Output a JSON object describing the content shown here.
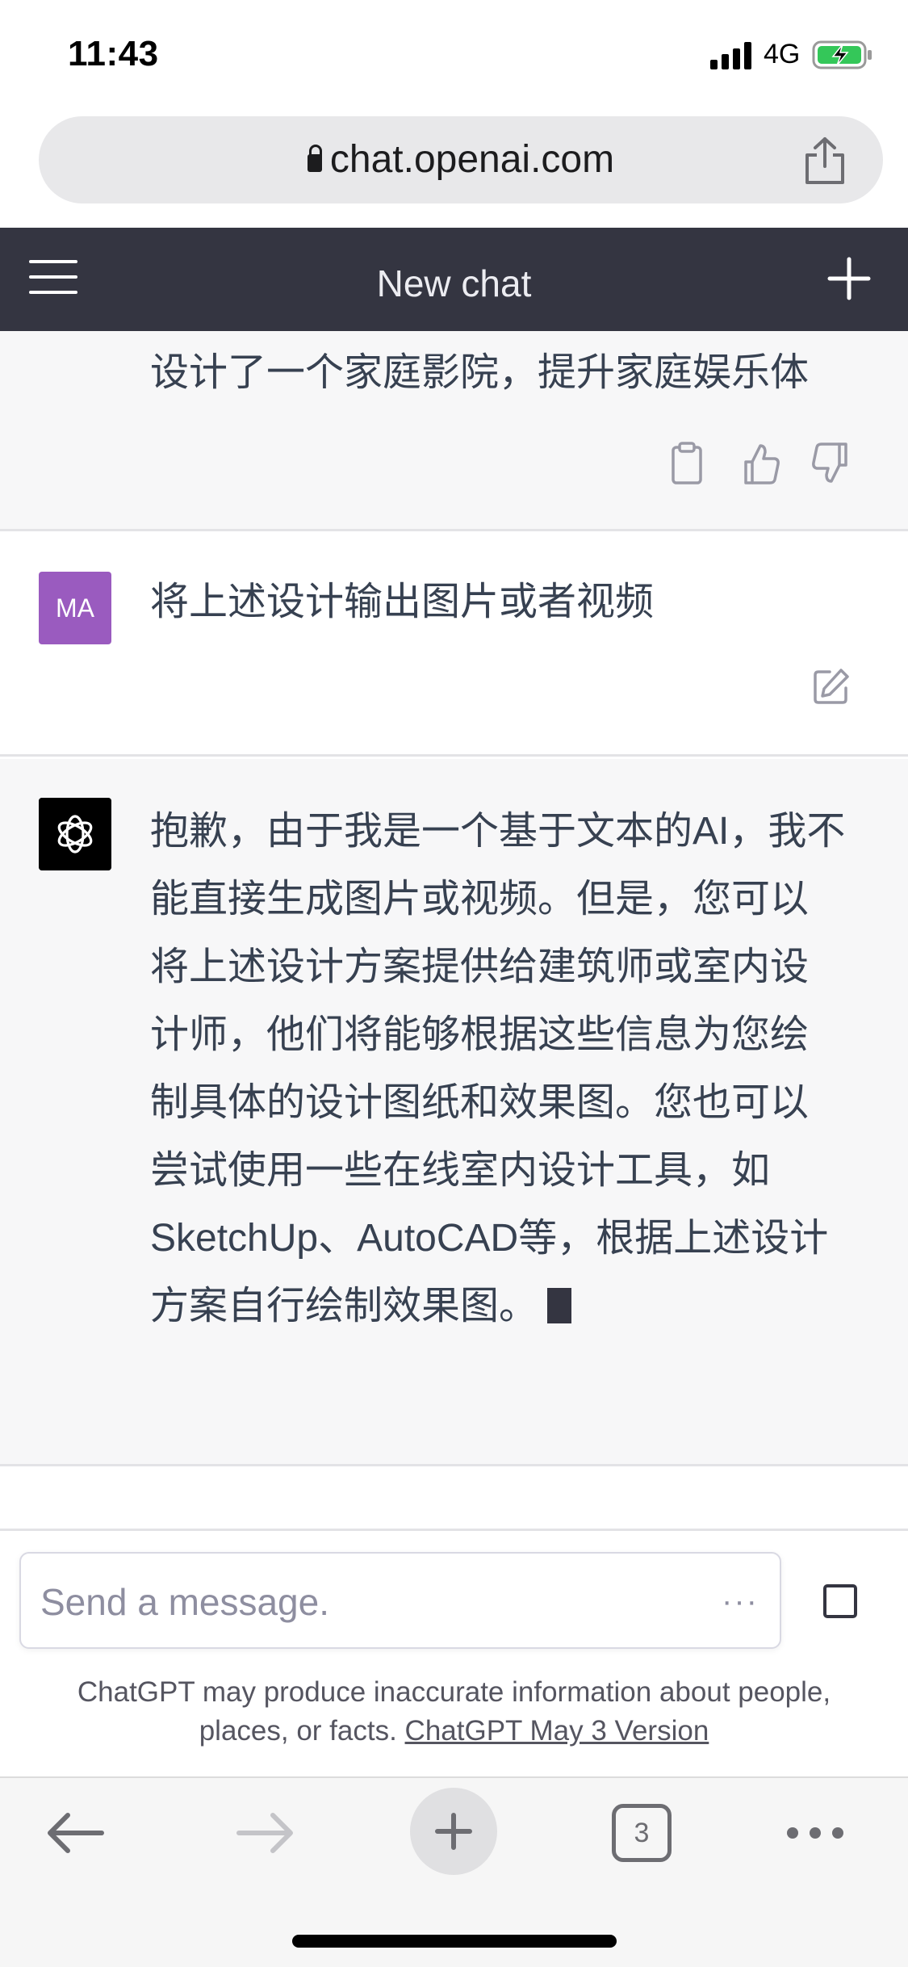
{
  "status_bar": {
    "time": "11:43",
    "network": "4G"
  },
  "browser": {
    "url": "chat.openai.com",
    "tab_count": "3"
  },
  "header": {
    "title": "New chat"
  },
  "conversation": {
    "previous_assistant_tail": "设计了一个家庭影院，提升家庭娱乐体",
    "user_message": {
      "avatar_initials": "MA",
      "text": "将上述设计输出图片或者视频"
    },
    "assistant_message": {
      "lines": [
        "抱歉，由于我是一个基于文本的AI，我不",
        "能直接生成图片或视频。但是，您可以",
        "将上述设计方案提供给建筑师或室内设",
        "计师，他们将能够根据这些信息为您绘",
        "制具体的设计图纸和效果图。您也可以",
        "尝试使用一些在线室内设计工具，如",
        "SketchUp、AutoCAD等，根据上述设计",
        "方案自行绘制效果图。"
      ]
    }
  },
  "composer": {
    "placeholder": "Send a message.",
    "more_glyph": "···"
  },
  "disclaimer": {
    "text": "ChatGPT may produce inaccurate information about people, places, or facts.",
    "link": "ChatGPT May 3 Version"
  },
  "colors": {
    "header_bg": "#343541",
    "assistant_bg": "#f7f7f8",
    "user_avatar": "#9a5bbf",
    "battery_green": "#34c759"
  },
  "icons": [
    "lock-icon",
    "share-icon",
    "menu-icon",
    "plus-icon",
    "clipboard-icon",
    "thumbs-up-icon",
    "thumbs-down-icon",
    "edit-icon",
    "openai-logo-icon",
    "back-arrow-icon",
    "forward-arrow-icon",
    "new-tab-plus-icon",
    "more-dots-icon"
  ]
}
